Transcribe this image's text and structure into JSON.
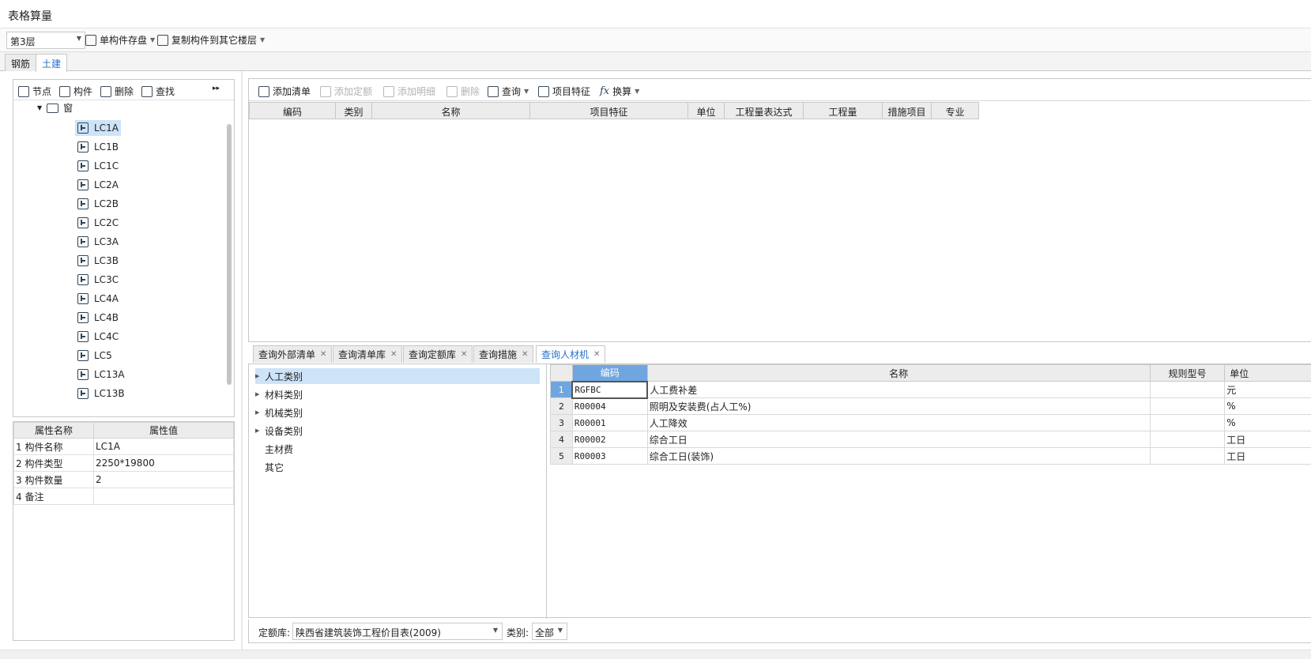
{
  "window": {
    "title": "表格算量"
  },
  "toolbar": {
    "floor_value": "第3层",
    "save_component_label": "单构件存盘",
    "copy_to_floors_label": "复制构件到其它楼层"
  },
  "main_tabs": [
    {
      "label": "钢筋"
    },
    {
      "label": "土建"
    }
  ],
  "left_toolbar": {
    "node": "节点",
    "component": "构件",
    "delete": "删除",
    "find": "查找"
  },
  "tree": {
    "folder": "窗",
    "items": [
      "LC1A",
      "LC1B",
      "LC1C",
      "LC2A",
      "LC2B",
      "LC2C",
      "LC3A",
      "LC3B",
      "LC3C",
      "LC4A",
      "LC4B",
      "LC4C",
      "LC5",
      "LC13A",
      "LC13B"
    ]
  },
  "properties": {
    "headers": [
      "属性名称",
      "属性值"
    ],
    "rows": [
      {
        "name": "1 构件名称",
        "value": "LC1A"
      },
      {
        "name": "2 构件类型",
        "value": "2250*19800"
      },
      {
        "name": "3 构件数量",
        "value": "2"
      },
      {
        "name": "4 备注",
        "value": ""
      }
    ]
  },
  "right_toolbar": {
    "add_list": "添加清单",
    "add_quota": "添加定额",
    "add_detail": "添加明细",
    "delete": "删除",
    "query": "查询",
    "project_feature": "项目特征",
    "convert": "换算"
  },
  "list_grid": {
    "headers": [
      "编码",
      "类别",
      "名称",
      "项目特征",
      "单位",
      "工程量表达式",
      "工程量",
      "措施项目",
      "专业"
    ]
  },
  "bottom_tabs": [
    {
      "label": "查询外部清单"
    },
    {
      "label": "查询清单库"
    },
    {
      "label": "查询定额库"
    },
    {
      "label": "查询措施"
    },
    {
      "label": "查询人材机"
    }
  ],
  "categories": [
    "人工类别",
    "材料类别",
    "机械类别",
    "设备类别",
    "主材费",
    "其它"
  ],
  "resource_grid": {
    "headers": [
      "编码",
      "名称",
      "规则型号",
      "单位"
    ],
    "rows": [
      {
        "no": "1",
        "code": "RGFBC",
        "name": "人工费补差",
        "spec": "",
        "unit": "元"
      },
      {
        "no": "2",
        "code": "R00004",
        "name": "照明及安装费(占人工%)",
        "spec": "",
        "unit": "%"
      },
      {
        "no": "3",
        "code": "R00001",
        "name": "人工降效",
        "spec": "",
        "unit": "%"
      },
      {
        "no": "4",
        "code": "R00002",
        "name": "综合工日",
        "spec": "",
        "unit": "工日"
      },
      {
        "no": "5",
        "code": "R00003",
        "name": "综合工日(装饰)",
        "spec": "",
        "unit": "工日"
      }
    ]
  },
  "statusbar": {
    "quota_lib_label": "定额库:",
    "quota_lib_value": "陕西省建筑装饰工程价目表(2009)",
    "type_label": "类别:",
    "type_value": "全部"
  },
  "colors": {
    "accent": "#2a6fc9",
    "selection": "#cde3f8",
    "header_highlight": "#6fa6e0"
  }
}
